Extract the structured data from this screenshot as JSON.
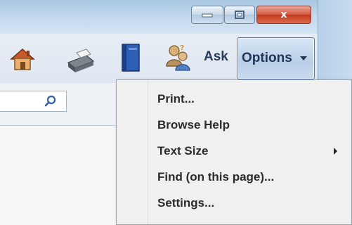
{
  "window": {
    "close_glyph": "x"
  },
  "toolbar": {
    "icons": [
      "home-icon",
      "printer-icon",
      "book-icon",
      "ask-people-icon"
    ],
    "ask_label": "Ask",
    "options_label": "Options"
  },
  "search": {
    "value": "",
    "placeholder": ""
  },
  "menu": {
    "items": [
      {
        "label": "Print..."
      },
      {
        "label": "Browse Help"
      },
      {
        "label": "Text Size"
      },
      {
        "label": "Find (on this page)..."
      },
      {
        "label": "Settings..."
      }
    ]
  },
  "colors": {
    "titlebar": "#bfd6ec",
    "close_button": "#c2381f",
    "menu_background": "#f0f0f0"
  }
}
